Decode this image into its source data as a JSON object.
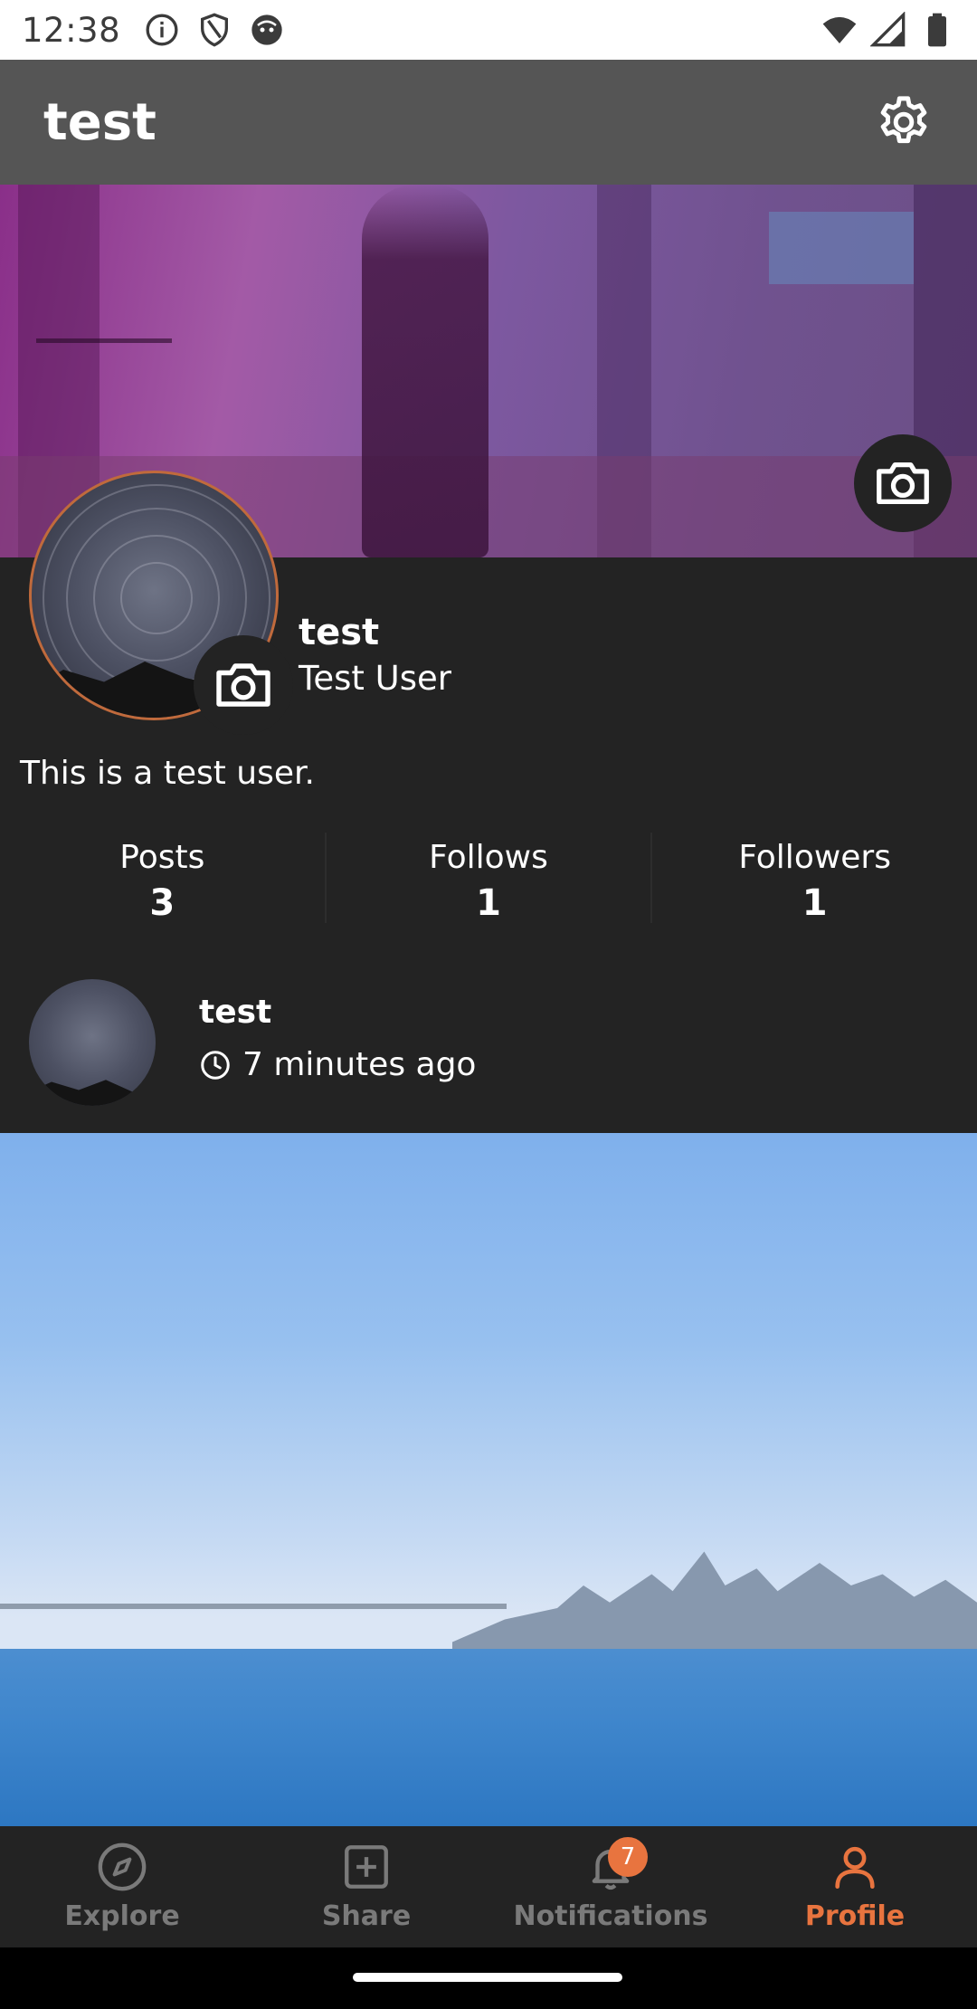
{
  "status_bar": {
    "time": "12:38",
    "icons": [
      "info-icon",
      "shield-icon",
      "android-icon"
    ],
    "right_icons": [
      "wifi-icon",
      "signal-icon",
      "battery-icon"
    ]
  },
  "app_bar": {
    "title": "test",
    "settings_icon": "gear-icon"
  },
  "profile": {
    "username": "test",
    "display_name": "Test User",
    "bio": "This is a test user.",
    "accent_color": "#e8743f"
  },
  "stats": [
    {
      "label": "Posts",
      "value": "3"
    },
    {
      "label": "Follows",
      "value": "1"
    },
    {
      "label": "Followers",
      "value": "1"
    }
  ],
  "post": {
    "username": "test",
    "time": "7 minutes ago"
  },
  "bottom_nav": {
    "items": [
      {
        "label": "Explore",
        "icon": "compass-icon"
      },
      {
        "label": "Share",
        "icon": "plus-square-icon"
      },
      {
        "label": "Notifications",
        "icon": "bell-icon",
        "badge": "7"
      },
      {
        "label": "Profile",
        "icon": "person-icon",
        "active": true
      }
    ]
  }
}
